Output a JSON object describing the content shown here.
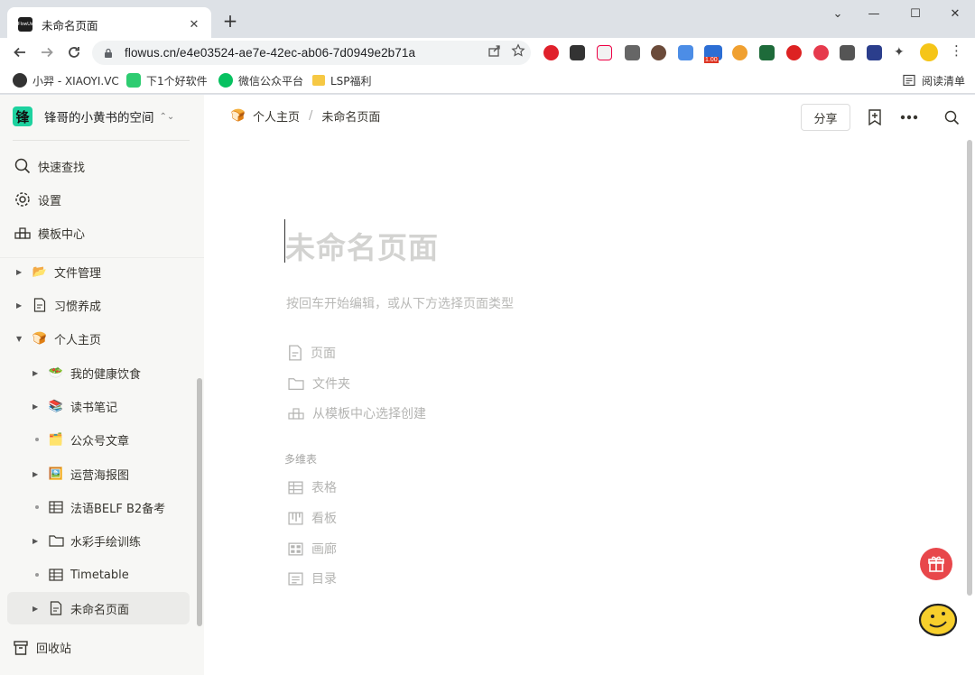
{
  "browser": {
    "tab_title": "未命名页面",
    "favicon_text": "FlowUs",
    "new_tab": "+",
    "url": "flowus.cn/e4e03524-ae7e-42ec-ab06-7d0949e2b71a",
    "ext_badge": "1.00"
  },
  "bookmarks": [
    {
      "label": "小羿 - XIAOYI.VC"
    },
    {
      "label": "下1个好软件"
    },
    {
      "label": "微信公众平台"
    },
    {
      "label": "LSP福利"
    }
  ],
  "reading_list": "阅读清单",
  "workspace": {
    "logo": "锋",
    "name": "锋哥的小黄书的空间"
  },
  "side_nav": [
    {
      "label": "快速查找"
    },
    {
      "label": "设置"
    },
    {
      "label": "模板中心"
    }
  ],
  "tree": [
    {
      "label": "文件管理",
      "emoji": "📂"
    },
    {
      "label": "习惯养成"
    },
    {
      "label": "个人主页",
      "emoji": "🍞"
    },
    {
      "label": "我的健康饮食",
      "emoji": "🥗"
    },
    {
      "label": "读书笔记",
      "emoji": "📚"
    },
    {
      "label": "公众号文章",
      "emoji": "🗂️"
    },
    {
      "label": "运营海报图",
      "emoji": "🖼️"
    },
    {
      "label": "法语BELF B2备考"
    },
    {
      "label": "水彩手绘训练"
    },
    {
      "label": "Timetable"
    },
    {
      "label": "未命名页面"
    }
  ],
  "trash": "回收站",
  "breadcrumb": [
    {
      "label": "个人主页",
      "emoji": "🍞"
    },
    {
      "label": "未命名页面"
    }
  ],
  "breadcrumb_sep": "/",
  "share_label": "分享",
  "page": {
    "title_placeholder": "未命名页面",
    "hint": "按回车开始编辑，或从下方选择页面类型",
    "options": [
      {
        "label": "页面",
        "icon": "page-icon"
      },
      {
        "label": "文件夹",
        "icon": "folder-icon"
      },
      {
        "label": "从模板中心选择创建",
        "icon": "template-icon"
      }
    ],
    "section_label": "多维表",
    "table_options": [
      {
        "label": "表格",
        "icon": "table-icon"
      },
      {
        "label": "看板",
        "icon": "board-icon"
      },
      {
        "label": "画廊",
        "icon": "gallery-icon"
      },
      {
        "label": "目录",
        "icon": "list-icon"
      }
    ]
  }
}
